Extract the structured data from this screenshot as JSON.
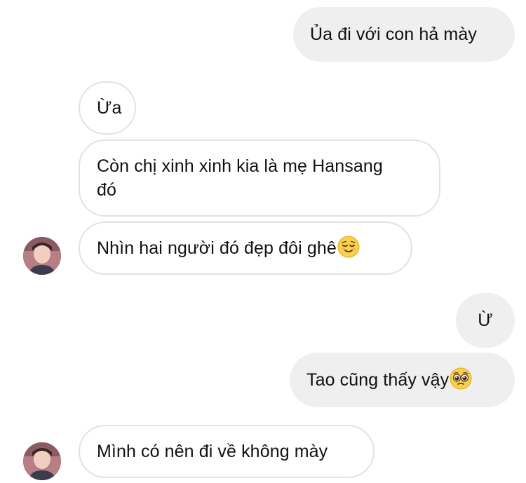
{
  "messages": [
    {
      "side": "sent",
      "text": "Ủa đi với con hả mày"
    },
    {
      "side": "received",
      "text": "Ừa"
    },
    {
      "side": "received",
      "text": "Còn chị xinh xinh kia là mẹ Hansang\nđó"
    },
    {
      "side": "received",
      "text": "Nhìn hai người đó đẹp đôi ghê",
      "emoji": "relieved-face"
    },
    {
      "side": "sent",
      "text": "Ừ"
    },
    {
      "side": "sent",
      "text": "Tao cũng thấy vậy",
      "emoji": "pleading-face"
    },
    {
      "side": "received",
      "text": "Mình có nên đi về không mày"
    }
  ],
  "colors": {
    "sent_bubble": "#efefef",
    "received_border": "#e2e2e2",
    "text": "#111111"
  }
}
